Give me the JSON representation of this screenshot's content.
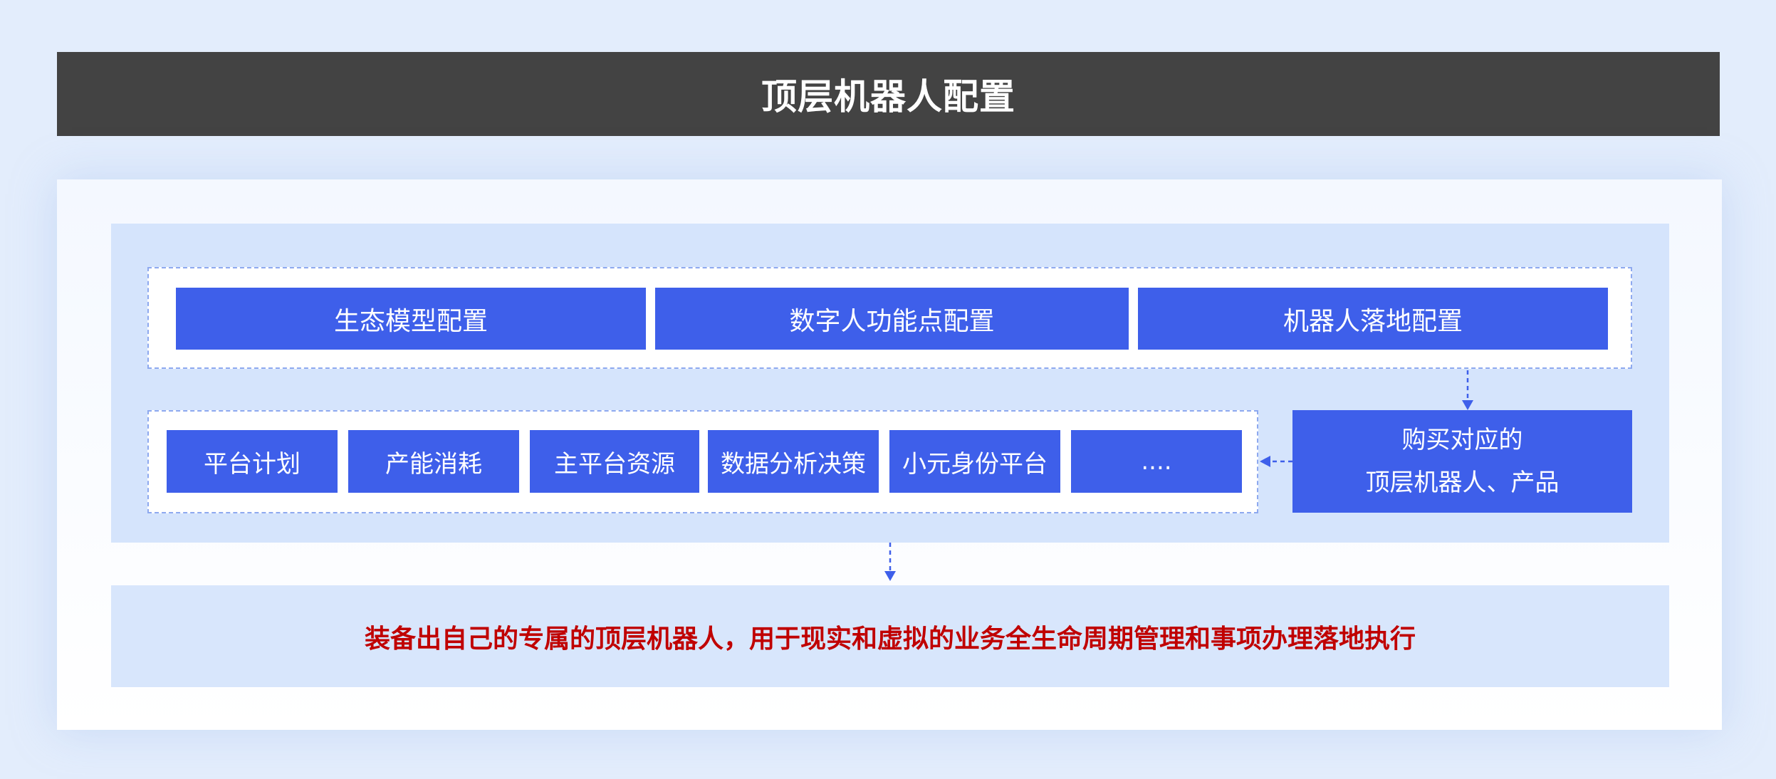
{
  "title": "顶层机器人配置",
  "top_configs": [
    "生态模型配置",
    "数字人功能点配置",
    "机器人落地配置"
  ],
  "modules": [
    "平台计划",
    "产能消耗",
    "主平台资源",
    "数据分析决策",
    "小元身份平台",
    "...."
  ],
  "purchase": {
    "line1": "购买对应的",
    "line2": "顶层机器人、产品"
  },
  "result": "装备出自己的专属的顶层机器人，用于现实和虚拟的业务全生命周期管理和事项办理落地执行",
  "colors": {
    "title_bg": "#434343",
    "box_blue": "#3e5fea",
    "panel_blue": "#d5e4fc",
    "dashed_border": "#8ea9ef",
    "result_text": "#c00000"
  }
}
